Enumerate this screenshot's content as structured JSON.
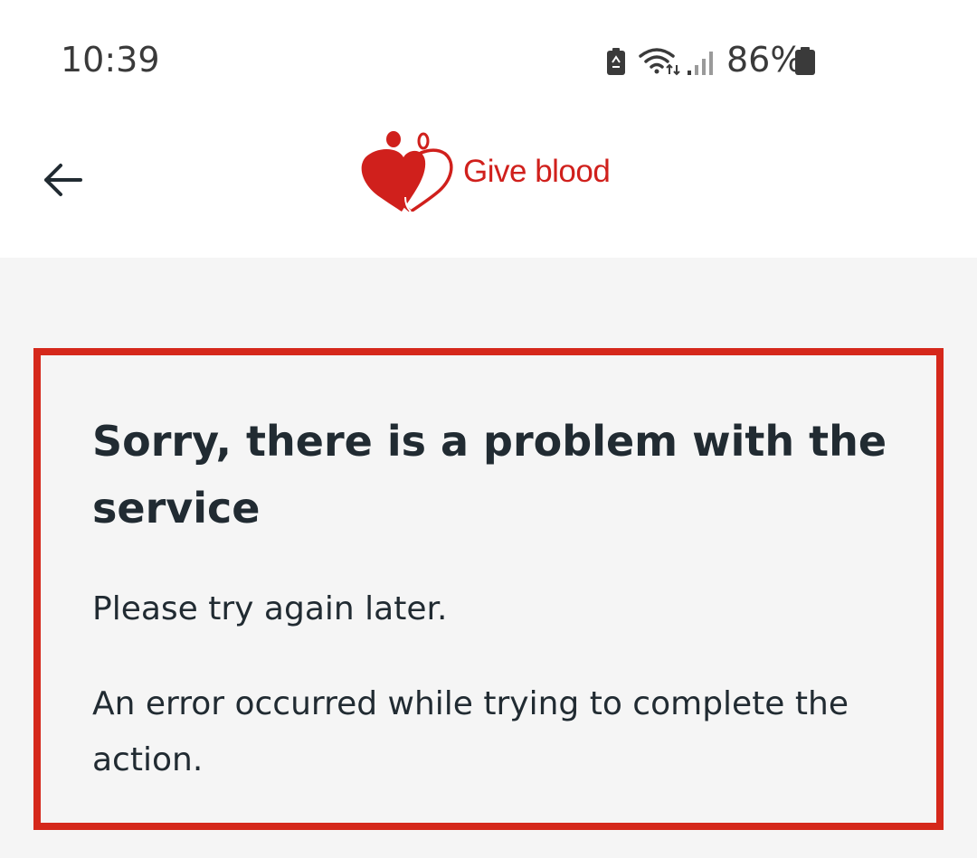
{
  "status_bar": {
    "time": "10:39",
    "battery_percent": "86%",
    "icons": [
      "battery-saver-icon",
      "wifi-icon",
      "signal-icon",
      "battery-icon"
    ]
  },
  "header": {
    "back_icon": "arrow-left-icon",
    "logo_text": "Give blood",
    "brand_color": "#d0201c"
  },
  "error": {
    "title": "Sorry, there is a problem with the service",
    "message_1": "Please try again later.",
    "message_2": "An error occurred while trying to complete the action.",
    "border_color": "#d5281b"
  }
}
